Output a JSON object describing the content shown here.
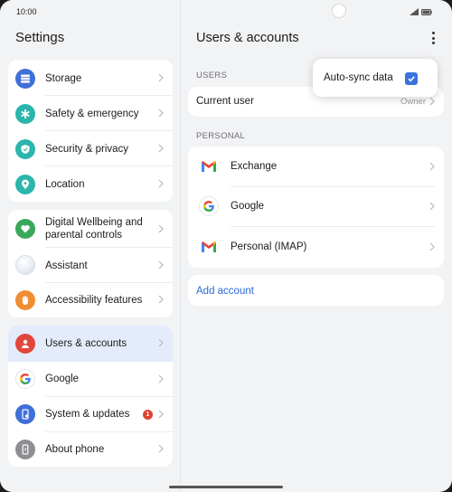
{
  "status": {
    "time": "10:00"
  },
  "left": {
    "title": "Settings",
    "group1": [
      {
        "label": "Storage",
        "icon": "storage-icon",
        "color": "#3f6fd8"
      },
      {
        "label": "Safety & emergency",
        "icon": "asterisk-icon",
        "color": "#2bb5ac"
      },
      {
        "label": "Security & privacy",
        "icon": "shield-icon",
        "color": "#2bb5ac"
      },
      {
        "label": "Location",
        "icon": "location-pin-icon",
        "color": "#2bb5ac"
      }
    ],
    "group2": [
      {
        "label": "Digital Wellbeing and parental controls",
        "icon": "heart-icon",
        "color": "#3aa85a"
      },
      {
        "label": "Assistant",
        "icon": "assistant-icon",
        "color": "#c9d8ea"
      },
      {
        "label": "Accessibility features",
        "icon": "hand-icon",
        "color": "#f08d32"
      }
    ],
    "group3": [
      {
        "label": "Users & accounts",
        "icon": "user-icon",
        "color": "#e2463a"
      },
      {
        "label": "Google",
        "icon": "google-icon",
        "color": "#ffffff"
      },
      {
        "label": "System & updates",
        "icon": "phone-settings-icon",
        "color": "#3f6fd8",
        "badge": "1"
      },
      {
        "label": "About phone",
        "icon": "phone-icon",
        "color": "#8e8e93"
      }
    ]
  },
  "right": {
    "title": "Users & accounts",
    "users_section": "USERS",
    "current_user_label": "Current user",
    "current_user_value": "Owner",
    "personal_section": "PERSONAL",
    "accounts": [
      {
        "label": "Exchange",
        "icon": "gmail-icon"
      },
      {
        "label": "Google",
        "icon": "google-icon"
      },
      {
        "label": "Personal (IMAP)",
        "icon": "gmail-icon"
      }
    ],
    "add_account": "Add account"
  },
  "popup": {
    "label": "Auto-sync data",
    "checked": true
  }
}
